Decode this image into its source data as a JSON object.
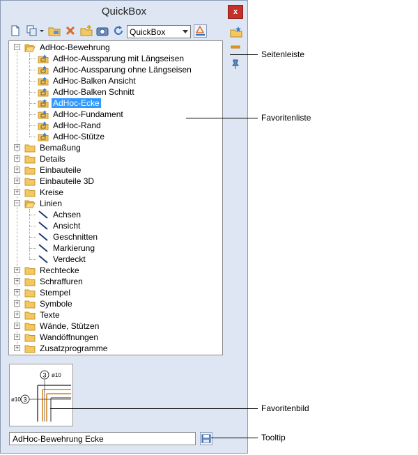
{
  "window": {
    "title": "QuickBox",
    "close_label": "x"
  },
  "toolbar": {
    "buttons": [
      "new-icon",
      "copy-icon",
      "open-folder-icon",
      "delete-icon",
      "new-folder-icon",
      "camera-icon",
      "refresh-icon",
      "filter-icon"
    ],
    "dropdown_value": "QuickBox"
  },
  "tree": {
    "items": [
      {
        "label": "AdHoc-Bewehrung",
        "level": 0,
        "expanded": true,
        "kind": "open-folder"
      },
      {
        "label": "AdHoc-Aussparung mit Längseisen",
        "level": 1,
        "kind": "favorite"
      },
      {
        "label": "AdHoc-Aussparung ohne Längseisen",
        "level": 1,
        "kind": "favorite"
      },
      {
        "label": "AdHoc-Balken Ansicht",
        "level": 1,
        "kind": "favorite"
      },
      {
        "label": "AdHoc-Balken Schnitt",
        "level": 1,
        "kind": "favorite"
      },
      {
        "label": "AdHoc-Ecke",
        "level": 1,
        "kind": "favorite",
        "selected": true
      },
      {
        "label": "AdHoc-Fundament",
        "level": 1,
        "kind": "favorite"
      },
      {
        "label": "AdHoc-Rand",
        "level": 1,
        "kind": "favorite"
      },
      {
        "label": "AdHoc-Stütze",
        "level": 1,
        "kind": "favorite"
      },
      {
        "label": "Bemaßung",
        "level": 0,
        "kind": "folder"
      },
      {
        "label": "Details",
        "level": 0,
        "kind": "folder"
      },
      {
        "label": "Einbauteile",
        "level": 0,
        "kind": "folder"
      },
      {
        "label": "Einbauteile 3D",
        "level": 0,
        "kind": "folder"
      },
      {
        "label": "Kreise",
        "level": 0,
        "kind": "folder"
      },
      {
        "label": "Linien",
        "level": 0,
        "expanded": true,
        "kind": "open-folder"
      },
      {
        "label": "Achsen",
        "level": 1,
        "kind": "line"
      },
      {
        "label": "Ansicht",
        "level": 1,
        "kind": "line"
      },
      {
        "label": "Geschnitten",
        "level": 1,
        "kind": "line"
      },
      {
        "label": "Markierung",
        "level": 1,
        "kind": "line"
      },
      {
        "label": "Verdeckt",
        "level": 1,
        "kind": "line"
      },
      {
        "label": "Rechtecke",
        "level": 0,
        "kind": "folder"
      },
      {
        "label": "Schraffuren",
        "level": 0,
        "kind": "folder"
      },
      {
        "label": "Stempel",
        "level": 0,
        "kind": "folder"
      },
      {
        "label": "Symbole",
        "level": 0,
        "kind": "folder"
      },
      {
        "label": "Texte",
        "level": 0,
        "kind": "folder"
      },
      {
        "label": "Wände, Stützen",
        "level": 0,
        "kind": "folder"
      },
      {
        "label": "Wandöffnungen",
        "level": 0,
        "kind": "folder"
      },
      {
        "label": "Zusatzprogramme",
        "level": 0,
        "kind": "folder"
      }
    ]
  },
  "preview": {
    "label_top": "3",
    "dim_top": "ø10",
    "label_left": "3",
    "dim_left": "ø10"
  },
  "tooltip": {
    "value": "AdHoc-Bewehrung Ecke"
  },
  "annotations": {
    "sidebar": "Seitenleiste",
    "favorites_list": "Favoritenliste",
    "favorite_image": "Favoritenbild",
    "tooltip": "Tooltip"
  },
  "colors": {
    "selection": "#3399ff",
    "folder": "#f5c760",
    "panel_bg": "#dde6f2",
    "close": "#c6302b"
  }
}
